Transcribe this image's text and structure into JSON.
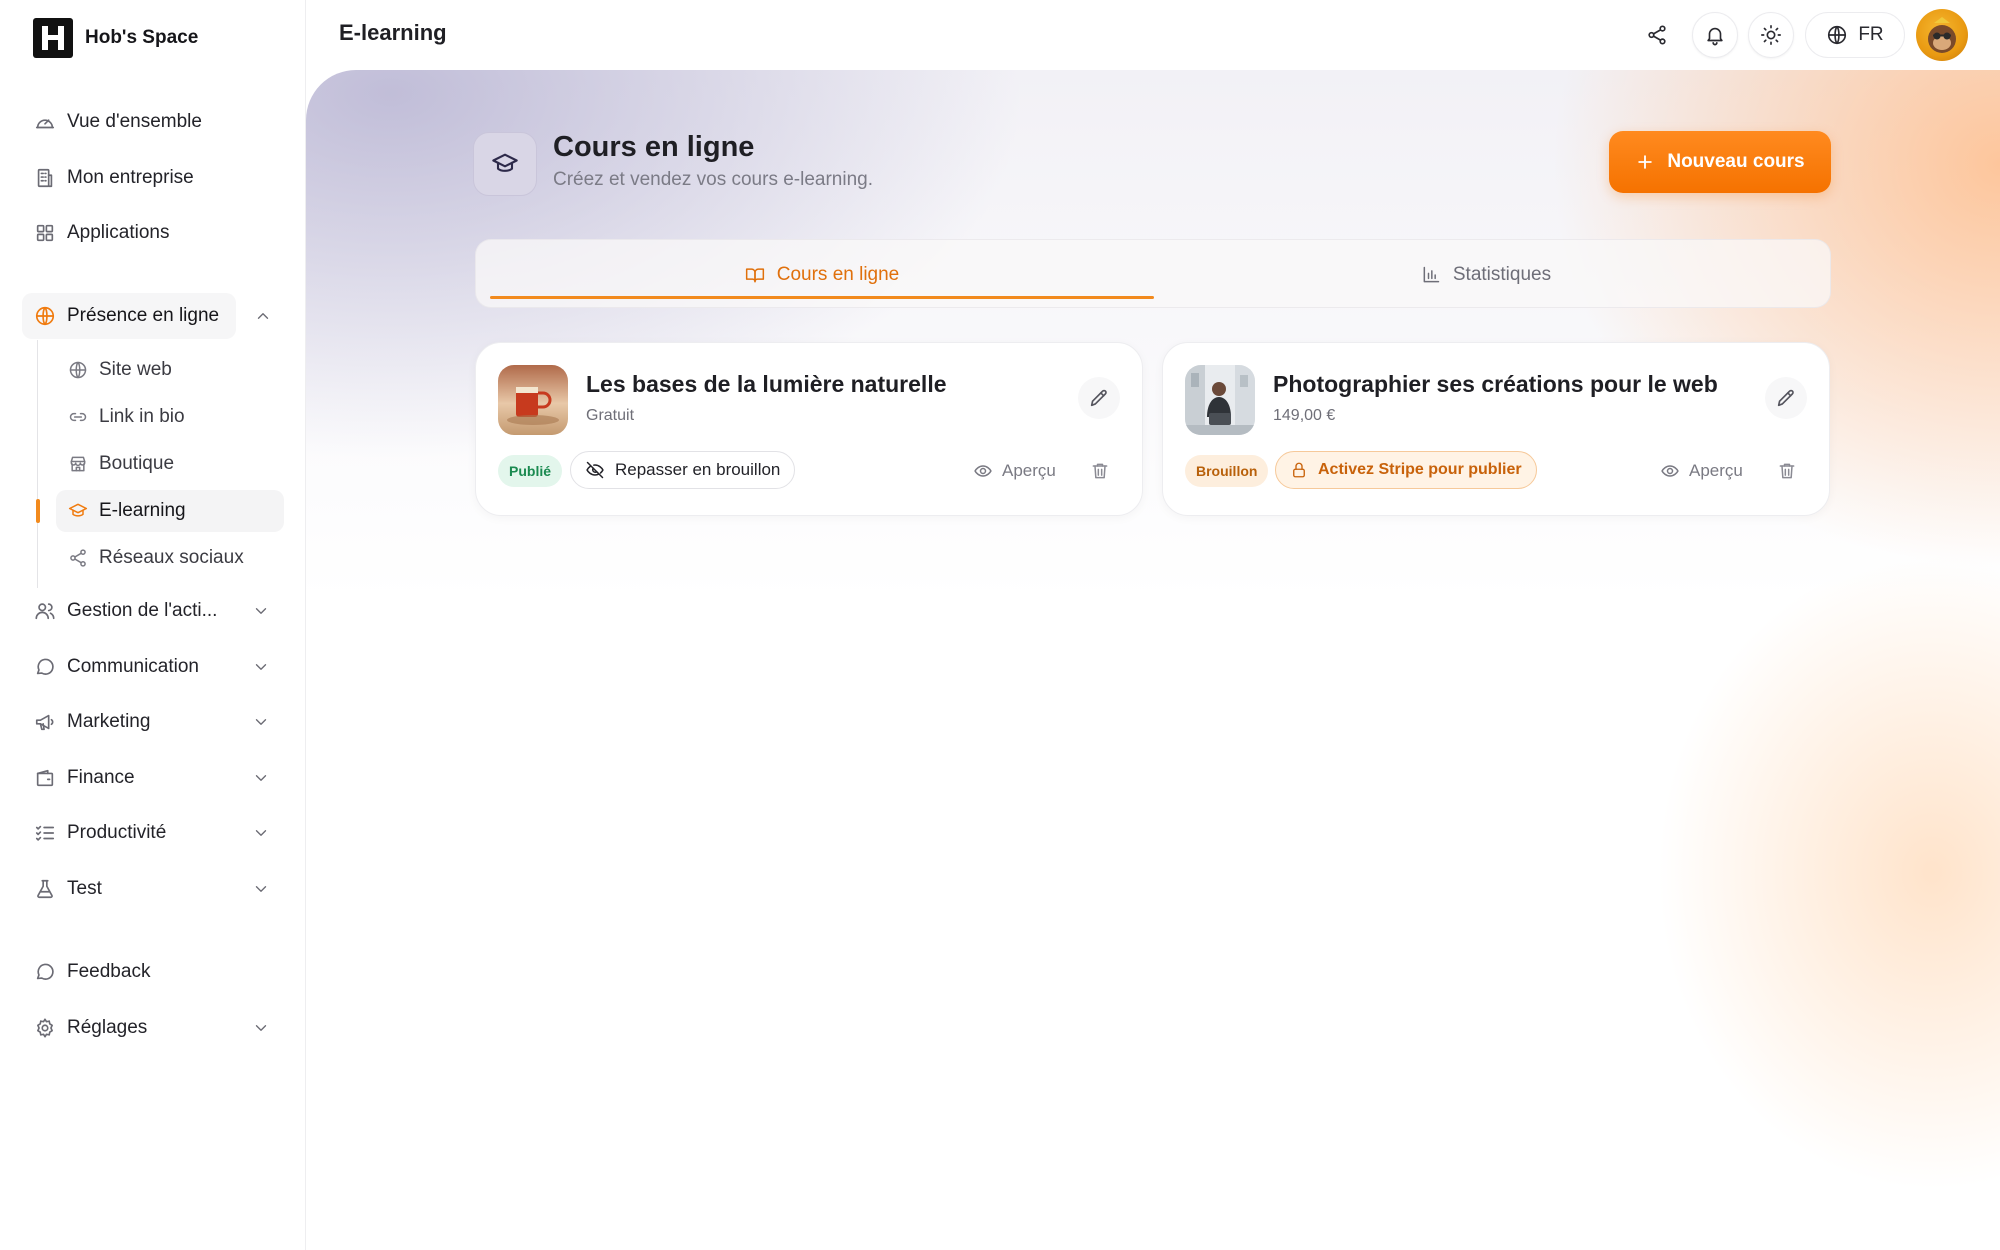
{
  "app": {
    "name": "Hob's Space"
  },
  "header": {
    "title": "E-learning",
    "language": "FR"
  },
  "sidebar": {
    "items": [
      {
        "label": "Vue d'ensemble"
      },
      {
        "label": "Mon entreprise"
      },
      {
        "label": "Applications"
      },
      {
        "label": "Présence en ligne"
      },
      {
        "label": "Gestion de l'acti..."
      },
      {
        "label": "Communication"
      },
      {
        "label": "Marketing"
      },
      {
        "label": "Finance"
      },
      {
        "label": "Productivité"
      },
      {
        "label": "Test"
      },
      {
        "label": "Feedback"
      },
      {
        "label": "Réglages"
      }
    ],
    "sub_items": [
      {
        "label": "Site web"
      },
      {
        "label": "Link in bio"
      },
      {
        "label": "Boutique"
      },
      {
        "label": "E-learning"
      },
      {
        "label": "Réseaux sociaux"
      }
    ]
  },
  "page": {
    "title": "Cours en ligne",
    "subtitle": "Créez et vendez vos cours e-learning.",
    "new_button": "Nouveau cours"
  },
  "tabs": [
    {
      "label": "Cours en ligne",
      "active": true
    },
    {
      "label": "Statistiques",
      "active": false
    }
  ],
  "courses": [
    {
      "title": "Les bases de la lumière naturelle",
      "price": "Gratuit",
      "status": "Publié",
      "action": "Repasser en brouillon",
      "preview": "Aperçu"
    },
    {
      "title": "Photographier ses créations pour le web",
      "price": "149,00 €",
      "status": "Brouillon",
      "action": "Activez Stripe pour publier",
      "preview": "Aperçu"
    }
  ],
  "colors": {
    "accent": "#f57200",
    "published": "#1a8a50",
    "draft": "#b8600a"
  }
}
